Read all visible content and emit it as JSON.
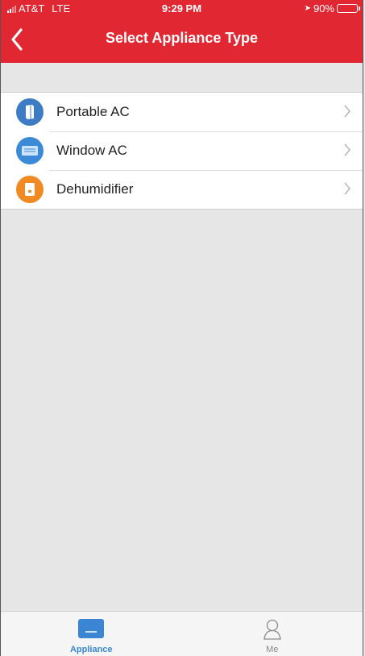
{
  "status_bar": {
    "carrier": "AT&T",
    "network": "LTE",
    "time": "9:29 PM",
    "battery": "90%",
    "battery_level": 0.9
  },
  "nav": {
    "title": "Select Appliance Type",
    "back_icon": "chevron-left-icon"
  },
  "appliances": [
    {
      "label": "Portable AC",
      "icon": "portable-ac-icon",
      "color": "#3d7bc4"
    },
    {
      "label": "Window AC",
      "icon": "window-ac-icon",
      "color": "#3a8ad8"
    },
    {
      "label": "Dehumidifier",
      "icon": "dehumidifier-icon",
      "color": "#f28a24"
    }
  ],
  "tabbar": {
    "tabs": [
      {
        "label": "Appliance",
        "icon": "appliance-icon",
        "active": true
      },
      {
        "label": "Me",
        "icon": "person-icon",
        "active": false
      }
    ]
  },
  "colors": {
    "brand_red": "#e12832",
    "active_blue": "#3a86d4",
    "background": "#e6e6e6"
  }
}
